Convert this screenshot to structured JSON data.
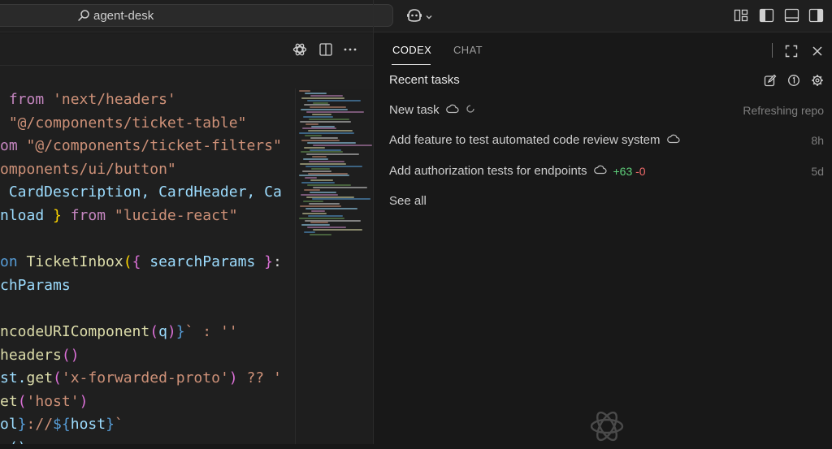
{
  "titlebar": {
    "search_text": "agent-desk",
    "icons": [
      "search-icon",
      "copilot-icon",
      "chevron-down-icon",
      "layout-customize-icon",
      "toggle-primary-sidebar-icon",
      "toggle-panel-icon",
      "toggle-secondary-sidebar-icon"
    ]
  },
  "editor": {
    "header_icons": [
      "openai-icon",
      "split-editor-icon",
      "more-actions-icon"
    ],
    "code_lines": [
      [
        {
          "t": " from ",
          "c": "#c586c0"
        },
        {
          "t": "'next/headers'",
          "c": "#ce9178"
        }
      ],
      [
        {
          "t": " ",
          "c": "#d4d4d4"
        },
        {
          "t": "\"@/components/ticket-table\"",
          "c": "#ce9178"
        }
      ],
      [
        {
          "t": "om ",
          "c": "#c586c0"
        },
        {
          "t": "\"@/components/ticket-filters\"",
          "c": "#ce9178"
        }
      ],
      [
        {
          "t": "omponents/ui/button\"",
          "c": "#ce9178"
        }
      ],
      [
        {
          "t": " CardDescription, CardHeader, Ca",
          "c": "#9cdcfe"
        }
      ],
      [
        {
          "t": "nload",
          "c": "#9cdcfe"
        },
        {
          "t": " } ",
          "c": "#ffd700"
        },
        {
          "t": "from ",
          "c": "#c586c0"
        },
        {
          "t": "\"lucide-react\"",
          "c": "#ce9178"
        }
      ],
      [
        {
          "t": "",
          "c": "#d4d4d4"
        }
      ],
      [
        {
          "t": "on ",
          "c": "#569cd6"
        },
        {
          "t": "TicketInbox",
          "c": "#dcdcaa"
        },
        {
          "t": "(",
          "c": "#ffd700"
        },
        {
          "t": "{",
          "c": "#da70d6"
        },
        {
          "t": " searchParams ",
          "c": "#9cdcfe"
        },
        {
          "t": "}",
          "c": "#da70d6"
        },
        {
          "t": ":",
          "c": "#d4d4d4"
        }
      ],
      [
        {
          "t": "chParams",
          "c": "#9cdcfe"
        }
      ],
      [
        {
          "t": "",
          "c": "#d4d4d4"
        }
      ],
      [
        {
          "t": "ncodeURIComponent",
          "c": "#dcdcaa"
        },
        {
          "t": "(",
          "c": "#da70d6"
        },
        {
          "t": "q",
          "c": "#9cdcfe"
        },
        {
          "t": ")",
          "c": "#da70d6"
        },
        {
          "t": "}",
          "c": "#569cd6"
        },
        {
          "t": "` : ''",
          "c": "#ce9178"
        }
      ],
      [
        {
          "t": "headers",
          "c": "#dcdcaa"
        },
        {
          "t": "()",
          "c": "#da70d6"
        }
      ],
      [
        {
          "t": "st.",
          "c": "#9cdcfe"
        },
        {
          "t": "get",
          "c": "#dcdcaa"
        },
        {
          "t": "(",
          "c": "#da70d6"
        },
        {
          "t": "'x-forwarded-proto'",
          "c": "#ce9178"
        },
        {
          "t": ")",
          "c": "#da70d6"
        },
        {
          "t": " ?? '",
          "c": "#ce9178"
        }
      ],
      [
        {
          "t": "et",
          "c": "#dcdcaa"
        },
        {
          "t": "(",
          "c": "#da70d6"
        },
        {
          "t": "'host'",
          "c": "#ce9178"
        },
        {
          "t": ")",
          "c": "#da70d6"
        }
      ],
      [
        {
          "t": "ol",
          "c": "#9cdcfe"
        },
        {
          "t": "}",
          "c": "#569cd6"
        },
        {
          "t": "://",
          "c": "#ce9178"
        },
        {
          "t": "${",
          "c": "#569cd6"
        },
        {
          "t": "host",
          "c": "#9cdcfe"
        },
        {
          "t": "}",
          "c": "#569cd6"
        },
        {
          "t": "`",
          "c": "#ce9178"
        }
      ],
      [
        {
          "t": " ()",
          "c": "#9cdcfe"
        }
      ]
    ]
  },
  "panel": {
    "tabs": [
      {
        "label": "CODEX",
        "active": true
      },
      {
        "label": "CHAT",
        "active": false
      }
    ],
    "header_icons": [
      "maximize-icon",
      "close-icon"
    ],
    "recent_tasks_title": "Recent tasks",
    "recent_icons": [
      "new-task-icon",
      "history-icon",
      "settings-icon"
    ],
    "tasks": [
      {
        "label": "New task",
        "status": "Refreshing repo",
        "cloud": true,
        "spinner": true
      },
      {
        "label": "Add feature to test automated code review system",
        "status": "8h",
        "cloud": true
      },
      {
        "label": "Add authorization tests for endpoints",
        "status": "5d",
        "cloud": true,
        "additions": "+63",
        "deletions": "-0"
      }
    ],
    "see_all": "See all",
    "footer_icon": "openai-logo-icon"
  },
  "colors": {
    "editor_bg": "#1f1f1f",
    "panel_bg": "#181818",
    "text": "#cccccc",
    "muted": "#7e7e7e",
    "additions": "#5fd17b",
    "deletions": "#f06a6a"
  }
}
